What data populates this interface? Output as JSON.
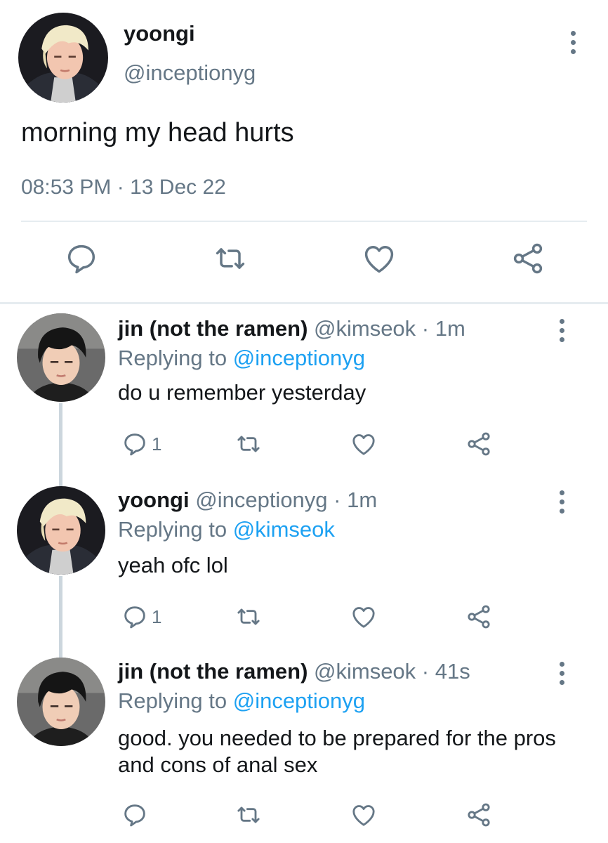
{
  "main_tweet": {
    "name": "yoongi",
    "handle": "@inceptionyg",
    "text": "morning my head hurts",
    "timestamp": "08:53 PM · 13 Dec 22",
    "icons": [
      "reply-icon",
      "retweet-icon",
      "like-icon",
      "share-icon",
      "more-icon"
    ]
  },
  "replies": [
    {
      "name": "jin (not the ramen)",
      "meta": "@kimseok · 1m",
      "replying_prefix": "Replying to ",
      "replying_to": "@inceptionyg",
      "text": "do u remember yesterday",
      "reply_count": "1"
    },
    {
      "name": "yoongi",
      "meta": "@inceptionyg · 1m",
      "replying_prefix": "Replying to ",
      "replying_to": "@kimseok",
      "text": "yeah ofc lol",
      "reply_count": "1"
    },
    {
      "name": "jin (not the ramen)",
      "meta": "@kimseok · 41s",
      "replying_prefix": "Replying to ",
      "replying_to": "@inceptionyg",
      "text": "good. you needed to be prepared for the pros and cons of anal sex",
      "reply_count": ""
    }
  ],
  "colors": {
    "text": "#14171a",
    "secondary": "#657786",
    "link": "#1da1f2",
    "divider": "#e6ecf0",
    "thread_line": "#ccd6dd"
  }
}
